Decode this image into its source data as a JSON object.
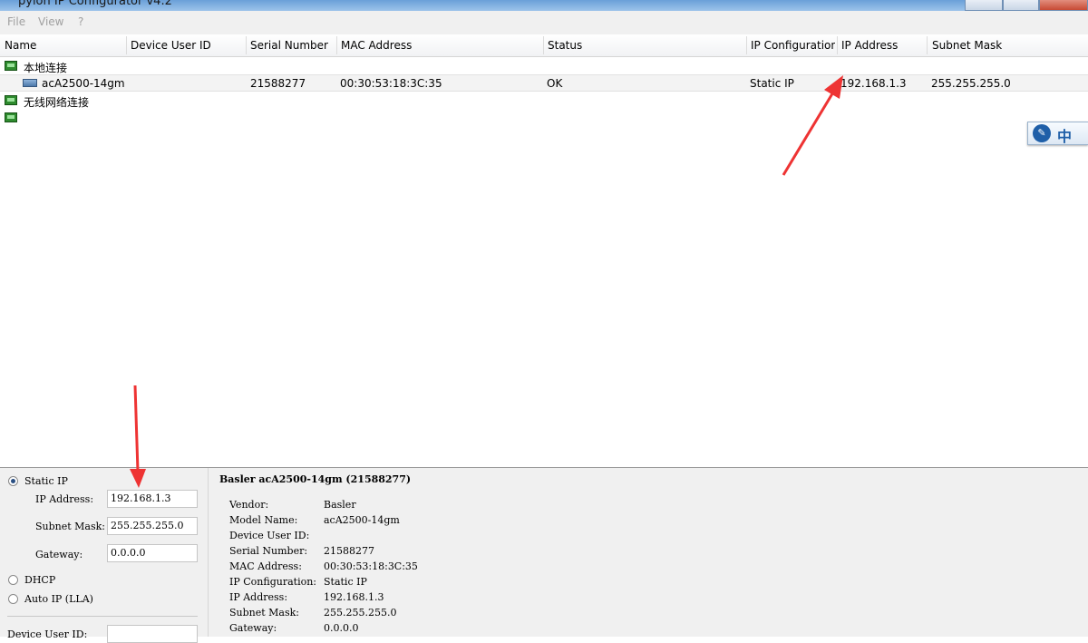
{
  "window": {
    "title": "pylon IP Configurator v4.2"
  },
  "menu": {
    "file": "File",
    "view": "View",
    "help": "?"
  },
  "columns": [
    "Name",
    "Device User ID",
    "Serial Number",
    "MAC Address",
    "Status",
    "IP Configuration",
    "IP Address",
    "Subnet Mask"
  ],
  "adapters": [
    {
      "name": "本地连接"
    },
    {
      "name": "无线网络连接"
    },
    {
      "name": ""
    }
  ],
  "device": {
    "name": "acA2500-14gm",
    "user_id": "",
    "serial": "21588277",
    "mac": "00:30:53:18:3C:35",
    "status": "OK",
    "ip_config": "Static IP",
    "ip": "192.168.1.3",
    "subnet": "255.255.255.0"
  },
  "ime": {
    "text": "中"
  },
  "form": {
    "static_label": "Static IP",
    "ip_label": "IP Address:",
    "ip_value": "192.168.1.3",
    "subnet_label": "Subnet Mask:",
    "subnet_value": "255.255.255.0",
    "gateway_label": "Gateway:",
    "gateway_value": "0.0.0.0",
    "dhcp_label": "DHCP",
    "autoip_label": "Auto IP (LLA)",
    "userid_label": "Device User ID:",
    "userid_value": ""
  },
  "details": {
    "heading": "Basler acA2500-14gm (21588277)",
    "rows": [
      {
        "k": "Vendor:",
        "v": "Basler"
      },
      {
        "k": "Model Name:",
        "v": "acA2500-14gm"
      },
      {
        "k": "Device User ID:",
        "v": ""
      },
      {
        "k": "Serial Number:",
        "v": "21588277"
      },
      {
        "k": "MAC Address:",
        "v": "00:30:53:18:3C:35"
      },
      {
        "k": "IP Configuration:",
        "v": "Static IP"
      },
      {
        "k": "IP Address:",
        "v": "192.168.1.3"
      },
      {
        "k": "Subnet Mask:",
        "v": "255.255.255.0"
      },
      {
        "k": "Gateway:",
        "v": "0.0.0.0"
      }
    ]
  },
  "colors": {
    "arrow": "#ee3333",
    "nic": "#2e8b2e"
  }
}
